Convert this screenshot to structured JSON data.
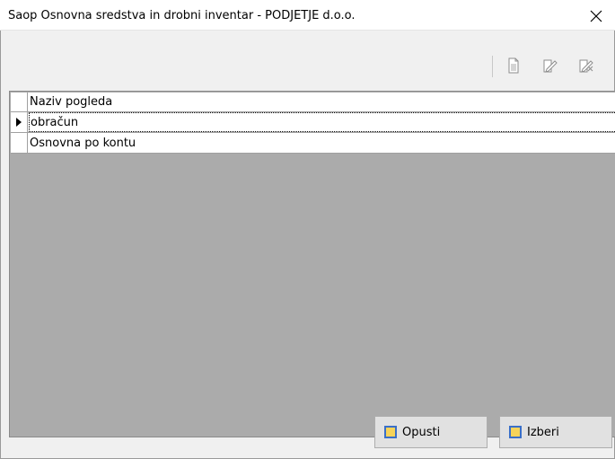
{
  "window": {
    "title": "Saop Osnovna sredstva in drobni inventar  - PODJETJE d.o.o."
  },
  "toolbar": {
    "icons": [
      "new-document-icon",
      "edit-document-icon",
      "delete-document-icon"
    ]
  },
  "grid": {
    "header": "Naziv pogleda",
    "rows": [
      {
        "label": "obračun",
        "selected": true
      },
      {
        "label": "Osnovna po kontu",
        "selected": false
      }
    ]
  },
  "buttons": {
    "cancel_label": "Opusti",
    "select_label": "Izberi"
  },
  "colors": {
    "grid_background": "#ababab",
    "button_icon_fill": "#f6d35a",
    "button_icon_border": "#3a6fc8"
  }
}
